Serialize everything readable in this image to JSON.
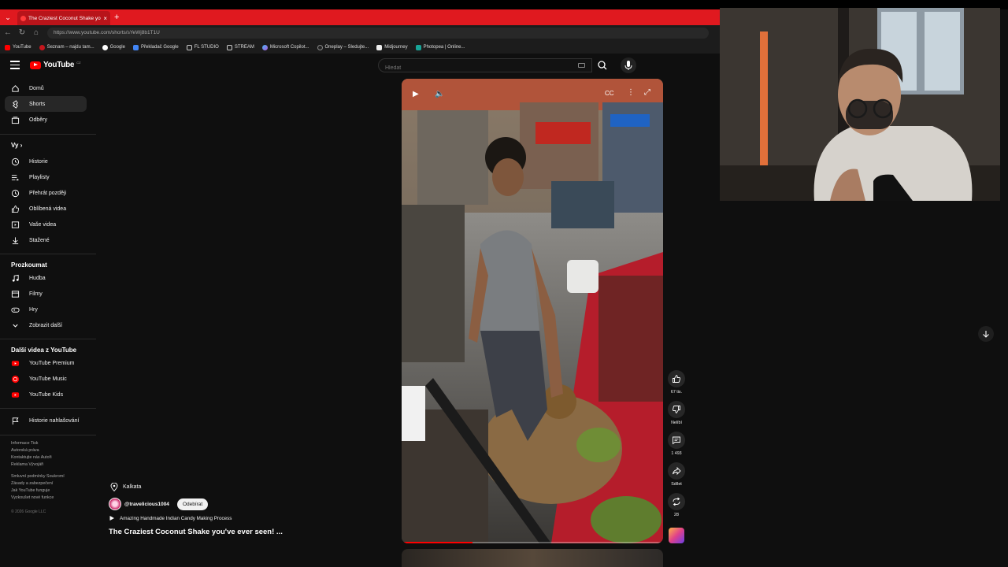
{
  "browser": {
    "tab_title": "The Craziest Coconut Shake you've...",
    "url": "https://www.youtube.com/shorts/sYeWj8b1T1U",
    "bookmarks": [
      "YouTube",
      "Seznam – najdu tam...",
      "Google",
      "Překladač Google",
      "FL STUDIO",
      "STREAM",
      "Microsoft Copilot...",
      "Oneplay – Sledujte...",
      "Midjourney",
      "Photopea | Online..."
    ]
  },
  "masthead": {
    "logo_text": "YouTube",
    "logo_sup": "CZ",
    "search_placeholder": "Hledat"
  },
  "sidebar": {
    "main": [
      {
        "label": "Domů",
        "icon": "home-icon"
      },
      {
        "label": "Shorts",
        "icon": "shorts-icon",
        "active": true
      },
      {
        "label": "Odběry",
        "icon": "subscriptions-icon"
      }
    ],
    "you_heading": "Vy",
    "you_items": [
      {
        "label": "Historie",
        "icon": "history-icon"
      },
      {
        "label": "Playlisty",
        "icon": "playlists-icon"
      },
      {
        "label": "Přehrát později",
        "icon": "watch-later-icon"
      },
      {
        "label": "Oblíbená videa",
        "icon": "liked-icon"
      },
      {
        "label": "Vaše videa",
        "icon": "your-videos-icon"
      },
      {
        "label": "Stažené",
        "icon": "downloads-icon"
      }
    ],
    "explore_heading": "Prozkoumat",
    "explore_items": [
      {
        "label": "Hudba",
        "icon": "music-icon"
      },
      {
        "label": "Filmy",
        "icon": "movies-icon"
      },
      {
        "label": "Hry",
        "icon": "gaming-icon"
      },
      {
        "label": "Zobrazit další",
        "icon": "chevron-down-icon"
      }
    ],
    "more_heading": "Další videa z YouTube",
    "more_items": [
      {
        "label": "YouTube Premium",
        "icon": "youtube-premium-icon"
      },
      {
        "label": "YouTube Music",
        "icon": "youtube-music-icon"
      },
      {
        "label": "YouTube Kids",
        "icon": "youtube-kids-icon"
      }
    ],
    "report_history": "Historie nahlašování",
    "footer1": [
      "Informace  Tisk",
      "Autorská práva",
      "Kontaktujte nás  Autoři",
      "Reklama  Vývojáři"
    ],
    "footer2": [
      "Smluvní podmínky  Soukromí",
      "Zásady a zabezpečení",
      "Jak YouTube funguje",
      "Vyzkoušet nové funkce"
    ],
    "copyright": "© 2026 Google LLC"
  },
  "short": {
    "location": "Kalkata",
    "channel": "@travelicious1004",
    "subscribe_label": "Odebírat",
    "suggested": "Amazing Handmade Indian Candy Making Process",
    "title": "The Craziest Coconut Shake you've ever seen! ...",
    "progress": 0.27,
    "actions": [
      {
        "name": "like",
        "count": "67 tis."
      },
      {
        "name": "dislike",
        "count": "Nelíbí"
      },
      {
        "name": "comments",
        "count": "1 493"
      },
      {
        "name": "share",
        "count": "Sdílet"
      },
      {
        "name": "remix",
        "count": "28"
      }
    ]
  },
  "colors": {
    "accent": "#ff0000",
    "tabbar": "#e0191f",
    "bg": "#0f0f0f"
  }
}
